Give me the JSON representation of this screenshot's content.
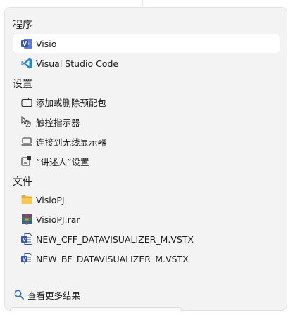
{
  "sections": {
    "programs": "程序",
    "settings": "设置",
    "files": "文件"
  },
  "programs": [
    {
      "label": "Visio",
      "icon": "visio-icon"
    },
    {
      "label": "Visual Studio Code",
      "icon": "vscode-icon"
    }
  ],
  "settings": [
    {
      "label": "添加或删除预配包",
      "icon": "briefcase-icon"
    },
    {
      "label": "触控指示器",
      "icon": "touch-pointer-icon"
    },
    {
      "label": "连接到无线显示器",
      "icon": "laptop-icon"
    },
    {
      "label": "“讲述人”设置",
      "icon": "narrator-icon"
    }
  ],
  "files": [
    {
      "label": "VisioPJ",
      "icon": "folder-icon"
    },
    {
      "label": "VisioPJ.rar",
      "icon": "winrar-archive-icon"
    },
    {
      "label": "NEW_CFF_DATAVISUALIZER_M.VSTX",
      "icon": "visio-template-icon"
    },
    {
      "label": "NEW_BF_DATAVISUALIZER_M.VSTX",
      "icon": "visio-template-icon"
    }
  ],
  "see_more": "查看更多结果",
  "colors": {
    "panel_bg": "#f3f3f3",
    "selected_bg": "#ffffff",
    "visio_blue": "#3955a3",
    "vscode_blue": "#1f8ad2",
    "folder_yellow": "#f7c948"
  }
}
